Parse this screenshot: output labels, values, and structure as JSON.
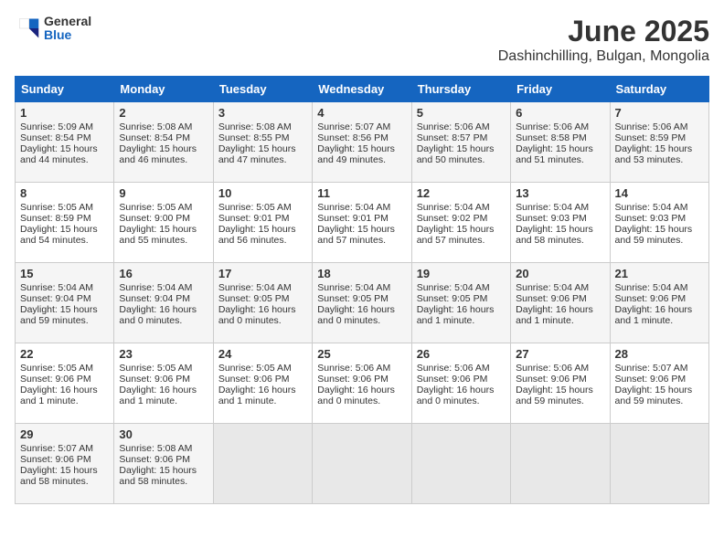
{
  "logo": {
    "general": "General",
    "blue": "Blue"
  },
  "title": "June 2025",
  "subtitle": "Dashinchilling, Bulgan, Mongolia",
  "weekdays": [
    "Sunday",
    "Monday",
    "Tuesday",
    "Wednesday",
    "Thursday",
    "Friday",
    "Saturday"
  ],
  "weeks": [
    [
      {
        "day": "1",
        "info": "Sunrise: 5:09 AM\nSunset: 8:54 PM\nDaylight: 15 hours\nand 44 minutes."
      },
      {
        "day": "2",
        "info": "Sunrise: 5:08 AM\nSunset: 8:54 PM\nDaylight: 15 hours\nand 46 minutes."
      },
      {
        "day": "3",
        "info": "Sunrise: 5:08 AM\nSunset: 8:55 PM\nDaylight: 15 hours\nand 47 minutes."
      },
      {
        "day": "4",
        "info": "Sunrise: 5:07 AM\nSunset: 8:56 PM\nDaylight: 15 hours\nand 49 minutes."
      },
      {
        "day": "5",
        "info": "Sunrise: 5:06 AM\nSunset: 8:57 PM\nDaylight: 15 hours\nand 50 minutes."
      },
      {
        "day": "6",
        "info": "Sunrise: 5:06 AM\nSunset: 8:58 PM\nDaylight: 15 hours\nand 51 minutes."
      },
      {
        "day": "7",
        "info": "Sunrise: 5:06 AM\nSunset: 8:59 PM\nDaylight: 15 hours\nand 53 minutes."
      }
    ],
    [
      {
        "day": "8",
        "info": "Sunrise: 5:05 AM\nSunset: 8:59 PM\nDaylight: 15 hours\nand 54 minutes."
      },
      {
        "day": "9",
        "info": "Sunrise: 5:05 AM\nSunset: 9:00 PM\nDaylight: 15 hours\nand 55 minutes."
      },
      {
        "day": "10",
        "info": "Sunrise: 5:05 AM\nSunset: 9:01 PM\nDaylight: 15 hours\nand 56 minutes."
      },
      {
        "day": "11",
        "info": "Sunrise: 5:04 AM\nSunset: 9:01 PM\nDaylight: 15 hours\nand 57 minutes."
      },
      {
        "day": "12",
        "info": "Sunrise: 5:04 AM\nSunset: 9:02 PM\nDaylight: 15 hours\nand 57 minutes."
      },
      {
        "day": "13",
        "info": "Sunrise: 5:04 AM\nSunset: 9:03 PM\nDaylight: 15 hours\nand 58 minutes."
      },
      {
        "day": "14",
        "info": "Sunrise: 5:04 AM\nSunset: 9:03 PM\nDaylight: 15 hours\nand 59 minutes."
      }
    ],
    [
      {
        "day": "15",
        "info": "Sunrise: 5:04 AM\nSunset: 9:04 PM\nDaylight: 15 hours\nand 59 minutes."
      },
      {
        "day": "16",
        "info": "Sunrise: 5:04 AM\nSunset: 9:04 PM\nDaylight: 16 hours\nand 0 minutes."
      },
      {
        "day": "17",
        "info": "Sunrise: 5:04 AM\nSunset: 9:05 PM\nDaylight: 16 hours\nand 0 minutes."
      },
      {
        "day": "18",
        "info": "Sunrise: 5:04 AM\nSunset: 9:05 PM\nDaylight: 16 hours\nand 0 minutes."
      },
      {
        "day": "19",
        "info": "Sunrise: 5:04 AM\nSunset: 9:05 PM\nDaylight: 16 hours\nand 1 minute."
      },
      {
        "day": "20",
        "info": "Sunrise: 5:04 AM\nSunset: 9:06 PM\nDaylight: 16 hours\nand 1 minute."
      },
      {
        "day": "21",
        "info": "Sunrise: 5:04 AM\nSunset: 9:06 PM\nDaylight: 16 hours\nand 1 minute."
      }
    ],
    [
      {
        "day": "22",
        "info": "Sunrise: 5:05 AM\nSunset: 9:06 PM\nDaylight: 16 hours\nand 1 minute."
      },
      {
        "day": "23",
        "info": "Sunrise: 5:05 AM\nSunset: 9:06 PM\nDaylight: 16 hours\nand 1 minute."
      },
      {
        "day": "24",
        "info": "Sunrise: 5:05 AM\nSunset: 9:06 PM\nDaylight: 16 hours\nand 1 minute."
      },
      {
        "day": "25",
        "info": "Sunrise: 5:06 AM\nSunset: 9:06 PM\nDaylight: 16 hours\nand 0 minutes."
      },
      {
        "day": "26",
        "info": "Sunrise: 5:06 AM\nSunset: 9:06 PM\nDaylight: 16 hours\nand 0 minutes."
      },
      {
        "day": "27",
        "info": "Sunrise: 5:06 AM\nSunset: 9:06 PM\nDaylight: 15 hours\nand 59 minutes."
      },
      {
        "day": "28",
        "info": "Sunrise: 5:07 AM\nSunset: 9:06 PM\nDaylight: 15 hours\nand 59 minutes."
      }
    ],
    [
      {
        "day": "29",
        "info": "Sunrise: 5:07 AM\nSunset: 9:06 PM\nDaylight: 15 hours\nand 58 minutes."
      },
      {
        "day": "30",
        "info": "Sunrise: 5:08 AM\nSunset: 9:06 PM\nDaylight: 15 hours\nand 58 minutes."
      },
      {
        "day": "",
        "info": ""
      },
      {
        "day": "",
        "info": ""
      },
      {
        "day": "",
        "info": ""
      },
      {
        "day": "",
        "info": ""
      },
      {
        "day": "",
        "info": ""
      }
    ]
  ]
}
